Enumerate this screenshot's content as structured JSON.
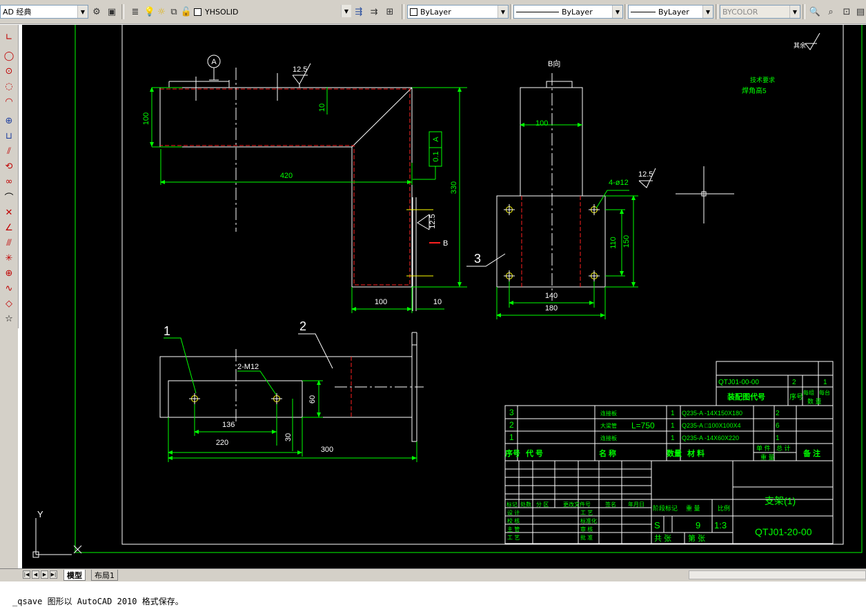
{
  "toolbar": {
    "workspace_value": "AD 经典",
    "layer_value": "YHSOLID",
    "color_value": "ByLayer",
    "linetype_value": "ByLayer",
    "lineweight_value": "ByLayer",
    "plotstyle_value": "BYCOLOR"
  },
  "drawing": {
    "callout_a": "A",
    "rough_top": "12.5",
    "dim_100_left": "100",
    "dim_10_top": "10",
    "tolerance_value": "0.1",
    "tolerance_datum": "A",
    "dim_420": "420",
    "dim_330": "330",
    "rough_side": "12.5",
    "label_b_arrow": "B",
    "dim_100_bottom": "100",
    "dim_10_bottom": "10",
    "view_b_label": "B向",
    "dim_100_view_b": "100",
    "hole_note": "4-ø12",
    "rough_view_b": "12.5",
    "dim_110": "110",
    "dim_150": "150",
    "part_3": "3",
    "dim_140": "140",
    "dim_180": "180",
    "rough_general": "其余",
    "tech_req_1": "技术要求",
    "tech_req_2": "焊角高5",
    "part_1": "1",
    "part_2": "2",
    "thread_note": "2-M12",
    "dim_60": "60",
    "dim_136": "136",
    "dim_30": "30",
    "dim_220": "220",
    "dim_300": "300"
  },
  "title_block": {
    "assembly_code": "QTJ01-00-00",
    "assembly_seq": "2",
    "assembly_qty": "1",
    "assembly_header": "装配图代号",
    "seq_header": "序号",
    "per_unit_header": "每组",
    "per_set_header": "每台",
    "qty_header": "数 量",
    "bom": [
      {
        "seq": "3",
        "name": "连接板",
        "qty": "1",
        "material": "Q235-A -14X150X180",
        "weight": "2"
      },
      {
        "seq": "2",
        "name": "大梁管",
        "note": "L=750",
        "qty": "1",
        "material": "Q235-A □100X100X4",
        "weight": "6"
      },
      {
        "seq": "1",
        "name": "连接板",
        "qty": "1",
        "material": "Q235-A -14X60X220",
        "weight": "1"
      }
    ],
    "col_seq": "序号",
    "col_code": "代 号",
    "col_name": "名 称",
    "col_qty": "数量",
    "col_material": "材 料",
    "col_unit_weight": "单 件",
    "col_total_weight": "总 计",
    "col_weight": "重 量",
    "col_remark": "备 注",
    "row_mark": "标记",
    "row_count": "处数",
    "row_zone": "分 区",
    "row_change": "更改文件号",
    "row_sign": "签名",
    "row_date": "年月日",
    "row_design": "设 计",
    "row_check": "校 核",
    "row_chief": "主 管",
    "row_process": "工 艺",
    "row_craft": "工 艺",
    "row_standard": "标准化",
    "row_review": "审 核",
    "row_approve": "批 准",
    "stage_mark": "阶段标记",
    "weight_label": "重 量",
    "scale_label": "比例",
    "stage_value": "S",
    "weight_value": "9",
    "scale_value": "1:3",
    "sheets_total": "共 张",
    "sheet_no": "第 张",
    "part_title": "支架(1)",
    "drawing_code": "QTJ01-20-00"
  },
  "ucs": {
    "y_label": "Y"
  },
  "tabs": {
    "model": "模型",
    "layout1": "布局1"
  },
  "command_line": {
    "text": "_qsave 图形以 AutoCAD 2010 格式保存。"
  }
}
